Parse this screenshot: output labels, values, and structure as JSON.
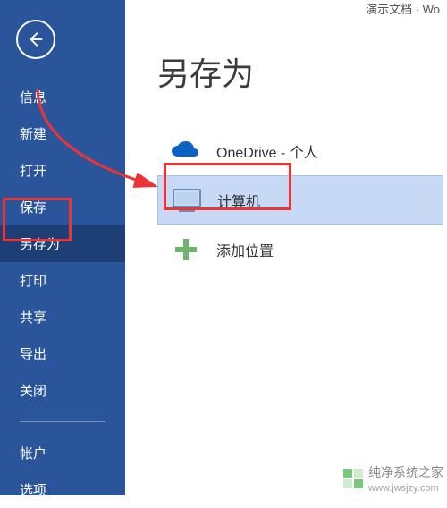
{
  "titlebar": {
    "doc_name": "演示文档 · Wo"
  },
  "sidebar": {
    "items": [
      {
        "label": "信息"
      },
      {
        "label": "新建"
      },
      {
        "label": "打开"
      },
      {
        "label": "保存"
      },
      {
        "label": "另存为",
        "selected": true
      },
      {
        "label": "打印"
      },
      {
        "label": "共享"
      },
      {
        "label": "导出"
      },
      {
        "label": "关闭"
      }
    ],
    "items2": [
      {
        "label": "帐户"
      },
      {
        "label": "选项"
      }
    ]
  },
  "main": {
    "title": "另存为",
    "locations": [
      {
        "label": "OneDrive - 个人",
        "icon": "onedrive"
      },
      {
        "label": "计算机",
        "icon": "computer",
        "selected": true
      },
      {
        "label": "添加位置",
        "icon": "add"
      }
    ]
  },
  "watermark": {
    "name": "纯净系统之家",
    "url": "www.jwsjzy.com"
  }
}
